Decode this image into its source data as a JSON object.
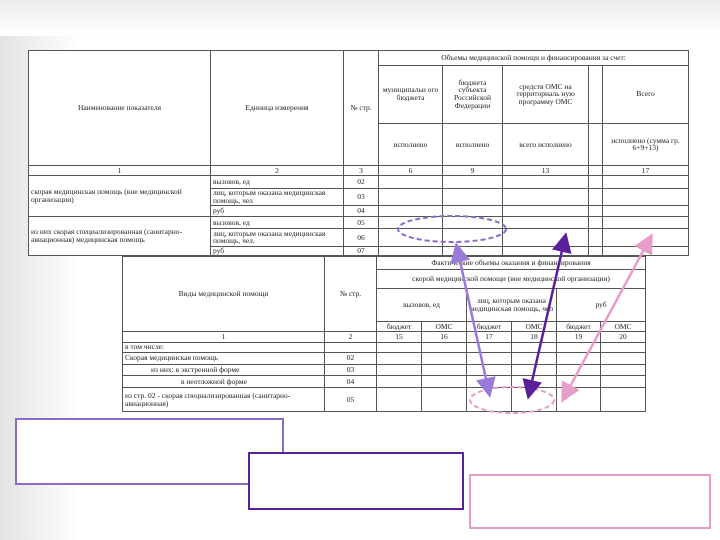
{
  "table1": {
    "header_main": "Объемы медицинской помощи и финансирования за счет:",
    "col_indicator": "Наименование показателя",
    "col_unit": "Единица измерения",
    "col_num": "№ стр.",
    "col_municipal": "муниципальн ого бюджета",
    "col_regional": "бюджета субъекта Российской Федерации",
    "col_oms": "средств ОМС на территориаль ную программу ОМС",
    "col_total": "Всего",
    "sub_executed_1": "исполнено",
    "sub_executed_2": "исполнено",
    "sub_executed_3": "всего исполнено",
    "sub_executed_4": "исполнено (сумма гр. 6+9+13)",
    "idx": [
      "1",
      "2",
      "3",
      "6",
      "9",
      "13",
      "17"
    ],
    "rows": [
      {
        "label": "скорая медицинская помощь (вне медицинской организации)",
        "units": [
          "вызовов, ед",
          "лиц, которым оказана медицинская помощь, чел",
          "руб"
        ],
        "nums": [
          "02",
          "03",
          "04"
        ]
      },
      {
        "label": "из них скорая специализированная (санитарно-авиационная) медицинская помощь",
        "units": [
          "вызовов, ед",
          "лиц, которым оказана медицинская помощь, чел.",
          "руб"
        ],
        "nums": [
          "05",
          "06",
          "07"
        ]
      }
    ]
  },
  "table2": {
    "header_main": "Фактические объемы оказания и финансирования",
    "sub_header": "скорой медицинской помощи (вне медицинской организации)",
    "col_types": "Виды медицинской помощи",
    "col_num": "№ стр.",
    "col_calls": "вызовов, ед",
    "col_persons": "лиц, которым оказана медицинская помощь, чел",
    "col_rub": "руб",
    "fund_labels": [
      "бюджет",
      "ОМС",
      "бюджет",
      "ОМС",
      "бюджет",
      "ОМС"
    ],
    "idx": [
      "1",
      "2",
      "15",
      "16",
      "17",
      "18",
      "19",
      "20"
    ],
    "rows": [
      {
        "label": "в том числе:",
        "num": ""
      },
      {
        "label": "Скорая медицинская помощь",
        "num": "02"
      },
      {
        "label": "из них: в экстренной форме",
        "num": "03"
      },
      {
        "label": "в неотложной форме",
        "num": "04"
      },
      {
        "label": "из стр. 02 - скорая специализированная (санитарно-авиационная)",
        "num": "05"
      }
    ]
  },
  "colors": {
    "arrow_light_purple": "#9a7ad8",
    "arrow_dark_purple": "#5a1f99",
    "arrow_pink": "#e79cc9"
  }
}
